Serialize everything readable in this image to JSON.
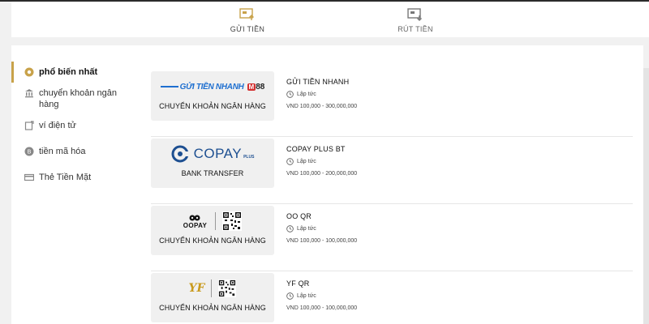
{
  "tabs": {
    "deposit": "GỬI TIỀN",
    "withdraw": "RÚT TIỀN"
  },
  "sidebar": {
    "items": [
      {
        "label": "phổ biến nhất",
        "icon": "popular-icon"
      },
      {
        "label": "chuyển khoản ngân hàng",
        "icon": "bank-icon"
      },
      {
        "label": "ví điện tử",
        "icon": "wallet-icon"
      },
      {
        "label": "tiền mã hóa",
        "icon": "crypto-icon"
      },
      {
        "label": "Thẻ Tiền Mặt",
        "icon": "cash-card-icon"
      }
    ]
  },
  "methods": [
    {
      "logo": {
        "left": "GỬI TIỀN NHANH",
        "badge": "M",
        "right": "88"
      },
      "type": "CHUYỂN KHOẢN NGÂN HÀNG",
      "name": "GỬI TIỀN NHANH",
      "speed": "Lập tức",
      "range": "VND 100,000 - 300,000,000"
    },
    {
      "logo": {
        "brand": "COPAY",
        "sub": "PLUS"
      },
      "type": "BANK TRANSFER",
      "name": "COPAY PLUS BT",
      "speed": "Lập tức",
      "range": "VND 100,000 - 200,000,000"
    },
    {
      "logo": {
        "brand": "OOPAY"
      },
      "type": "CHUYỂN KHOẢN NGÂN HÀNG",
      "name": "OO QR",
      "speed": "Lập tức",
      "range": "VND 100,000 - 100,000,000"
    },
    {
      "logo": {
        "brand": "YF"
      },
      "type": "CHUYỂN KHOẢN NGÂN HÀNG",
      "name": "YF QR",
      "speed": "Lập tức",
      "range": "VND 100,000 - 100,000,000"
    }
  ],
  "colors": {
    "accent": "#c8a24a",
    "panel": "#ffffff",
    "background": "#f1f1f1",
    "card": "#f0f0f0"
  }
}
